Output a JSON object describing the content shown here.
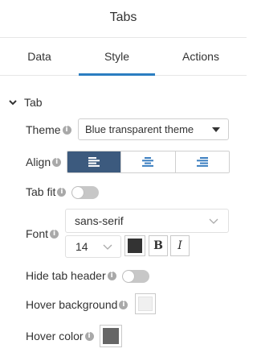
{
  "panel": {
    "title": "Tabs"
  },
  "tabs": [
    {
      "label": "Data",
      "active": false
    },
    {
      "label": "Style",
      "active": true
    },
    {
      "label": "Actions",
      "active": false
    }
  ],
  "section": {
    "label": "Tab"
  },
  "fields": {
    "theme": {
      "label": "Theme",
      "value": "Blue transparent theme"
    },
    "align": {
      "label": "Align",
      "options": [
        "left",
        "center",
        "right"
      ],
      "selected": "left"
    },
    "tab_fit": {
      "label": "Tab fit",
      "on": false
    },
    "font": {
      "label": "Font",
      "family": "sans-serif",
      "size": "14",
      "color": "#333333",
      "bold_label": "B",
      "italic_label": "I"
    },
    "hide_tab_header": {
      "label": "Hide tab header",
      "on": false
    },
    "hover_background": {
      "label": "Hover background",
      "color": "#f0f0f0"
    },
    "hover_color": {
      "label": "Hover color",
      "color": "#666666"
    }
  },
  "colors": {
    "accent": "#2b7ec1",
    "align_active": "#3c5a7e"
  }
}
